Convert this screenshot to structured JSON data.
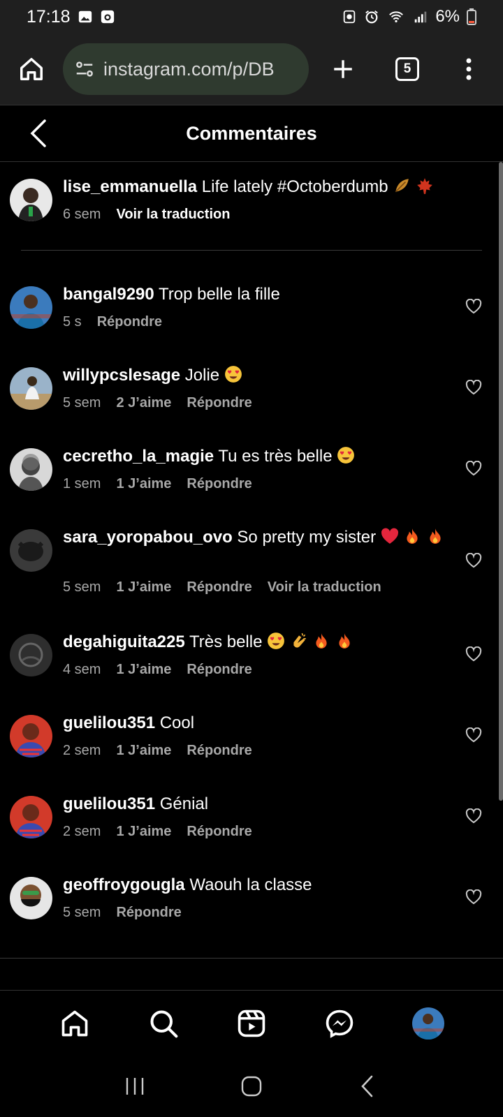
{
  "status_bar": {
    "time": "17:18",
    "battery": "6%",
    "icons": [
      "gallery-icon",
      "app-icon",
      "recycle-icon",
      "alarm-icon",
      "wifi-icon",
      "signal-icon",
      "battery-icon"
    ]
  },
  "browser": {
    "url": "instagram.com/p/DB",
    "tab_count": "5",
    "icons": [
      "home-icon",
      "site-settings-icon",
      "new-tab-icon",
      "menu-icon"
    ]
  },
  "header": {
    "title": "Commentaires"
  },
  "caption": {
    "username": "lise_emmanuella",
    "text": "Life lately #Octoberdumb",
    "emojis": [
      "fallen-leaf",
      "maple-leaf"
    ],
    "time": "6 sem",
    "translate": "Voir la traduction"
  },
  "comments": [
    {
      "username": "bangal9290",
      "text": "Trop belle la fille",
      "time": "5 s",
      "likes": "",
      "reply": "Répondre",
      "translate": ""
    },
    {
      "username": "willypcslesage",
      "text": "Jolie",
      "time": "5 sem",
      "likes": "2 J’aime",
      "reply": "Répondre",
      "translate": ""
    },
    {
      "username": "cecretho_la_magie",
      "text": "Tu es très belle",
      "time": "1 sem",
      "likes": "1 J’aime",
      "reply": "Répondre",
      "translate": ""
    },
    {
      "username": "sara_yoropabou_ovo",
      "text": "So pretty my sister",
      "time": "5 sem",
      "likes": "1 J’aime",
      "reply": "Répondre",
      "translate": "Voir la traduction"
    },
    {
      "username": "degahiguita225",
      "text": "Très belle",
      "time": "4 sem",
      "likes": "1 J’aime",
      "reply": "Répondre",
      "translate": ""
    },
    {
      "username": "guelilou351",
      "text": "Cool",
      "time": "2 sem",
      "likes": "1 J’aime",
      "reply": "Répondre",
      "translate": ""
    },
    {
      "username": "guelilou351",
      "text": "Génial",
      "time": "2 sem",
      "likes": "1 J’aime",
      "reply": "Répondre",
      "translate": ""
    },
    {
      "username": "geoffroygougla",
      "text": "Waouh la classe",
      "time": "5 sem",
      "likes": "",
      "reply": "Répondre",
      "translate": ""
    }
  ],
  "bottom_nav": {
    "items": [
      "home-icon",
      "search-icon",
      "reels-icon",
      "messenger-icon",
      "profile-avatar"
    ]
  },
  "system_nav": {
    "items": [
      "recents-icon",
      "home-circle-icon",
      "back-icon"
    ]
  },
  "colors": {
    "background": "#000000",
    "chrome": "#1f1f1f",
    "url_pill": "#2f3a2f",
    "secondary_text": "#a8a8a8",
    "divider": "#3a3a3a"
  }
}
